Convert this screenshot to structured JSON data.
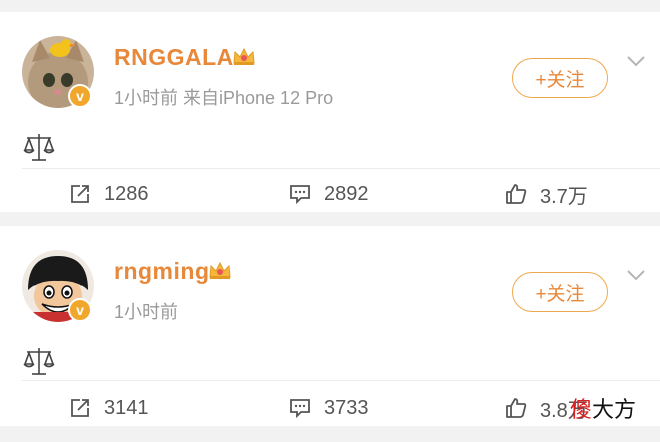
{
  "posts": [
    {
      "username": "RNGGALA",
      "meta": "1小时前  来自iPhone 12 Pro",
      "follow_label": "+关注",
      "reposts": "1286",
      "comments": "2892",
      "likes": "3.7万",
      "avatar": "cat-with-duck-avatar"
    },
    {
      "username": "rngming",
      "meta": "1小时前",
      "follow_label": "+关注",
      "reposts": "3141",
      "comments": "3733",
      "likes": "3.8万",
      "avatar": "luffy-avatar"
    }
  ],
  "verified_mark": "v",
  "watermark": {
    "part1": "傻",
    "part2": "大方"
  },
  "colors": {
    "accent": "#e8883a",
    "badge": "#f0a72b",
    "meta": "#9a9a9a"
  },
  "icons": [
    "crown-icon",
    "scale-icon",
    "repost-icon",
    "comment-icon",
    "like-icon",
    "chevron-down-icon"
  ]
}
